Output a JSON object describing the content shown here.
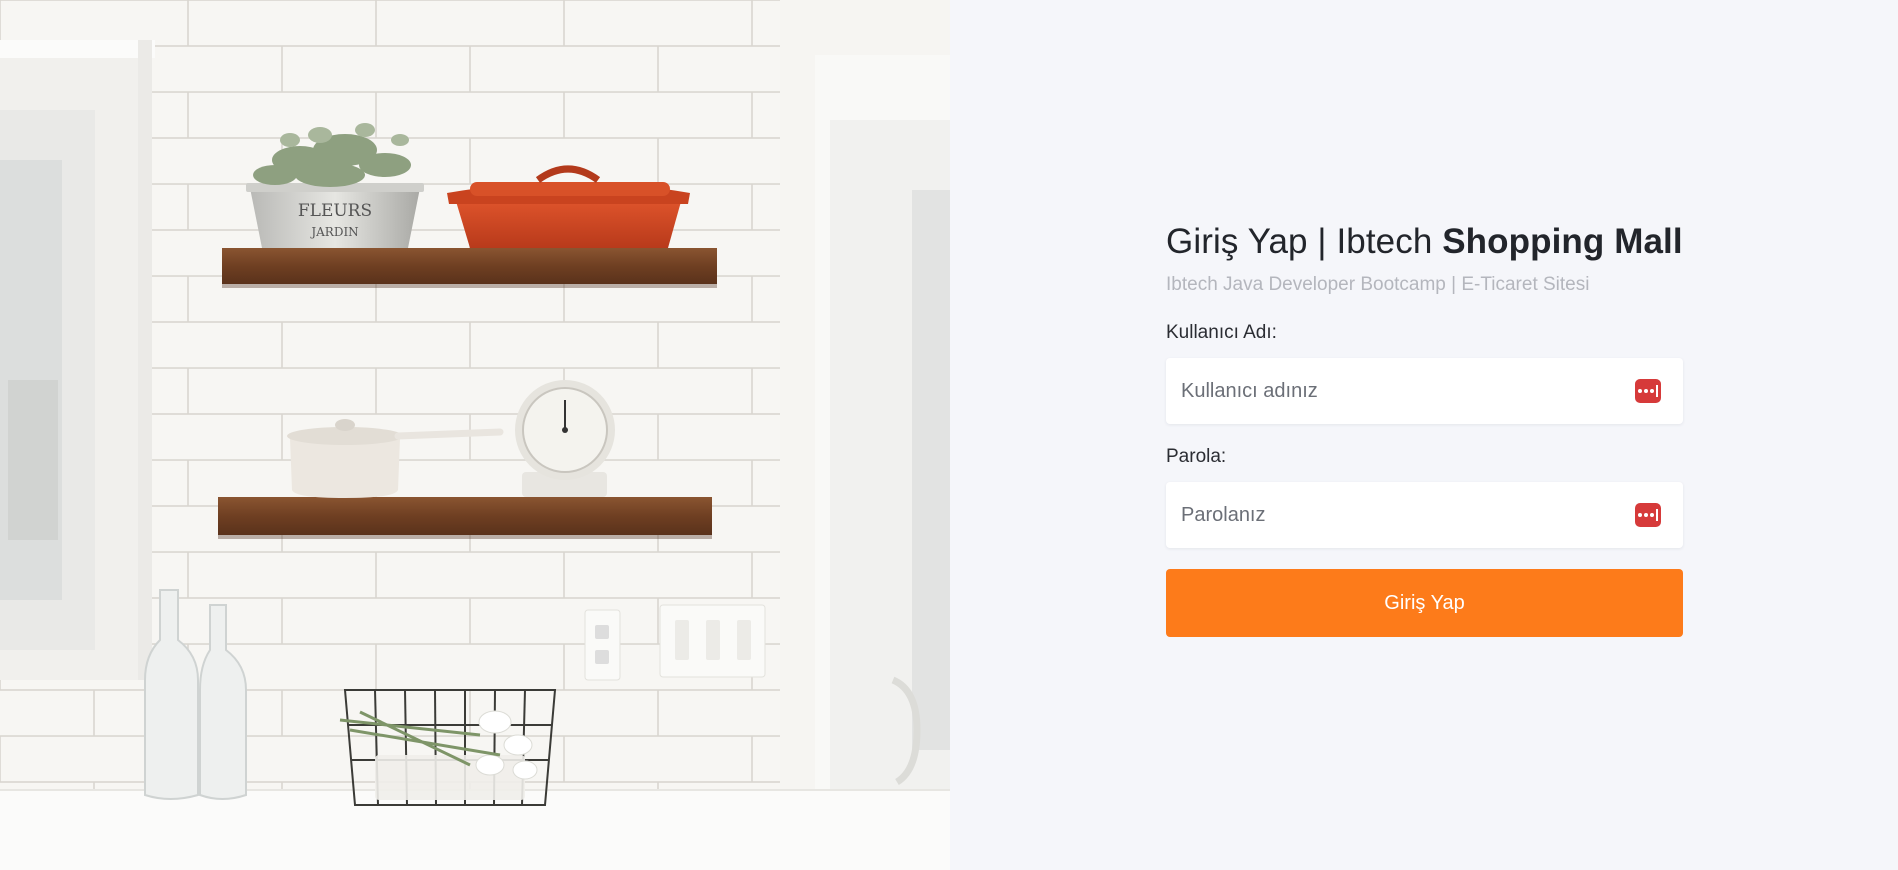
{
  "photo": {
    "alt": ""
  },
  "login": {
    "title_prefix": "Giriş Yap | Ibtech ",
    "title_bold": "Shopping Mall",
    "subtitle": "Ibtech Java Developer Bootcamp | E-Ticaret Sitesi",
    "username_label": "Kullanıcı Adı:",
    "username_placeholder": "Kullanıcı adınız",
    "username_value": "",
    "password_label": "Parola:",
    "password_placeholder": "Parolanız",
    "password_value": "",
    "submit_label": "Giriş Yap",
    "field_icon": "password-manager-icon"
  },
  "colors": {
    "accent": "#fd7b1a",
    "icon_red": "#d63a3a",
    "panel_bg": "#f5f6fa",
    "title_text": "#22252b",
    "subtitle_text": "#b4b6bd"
  }
}
